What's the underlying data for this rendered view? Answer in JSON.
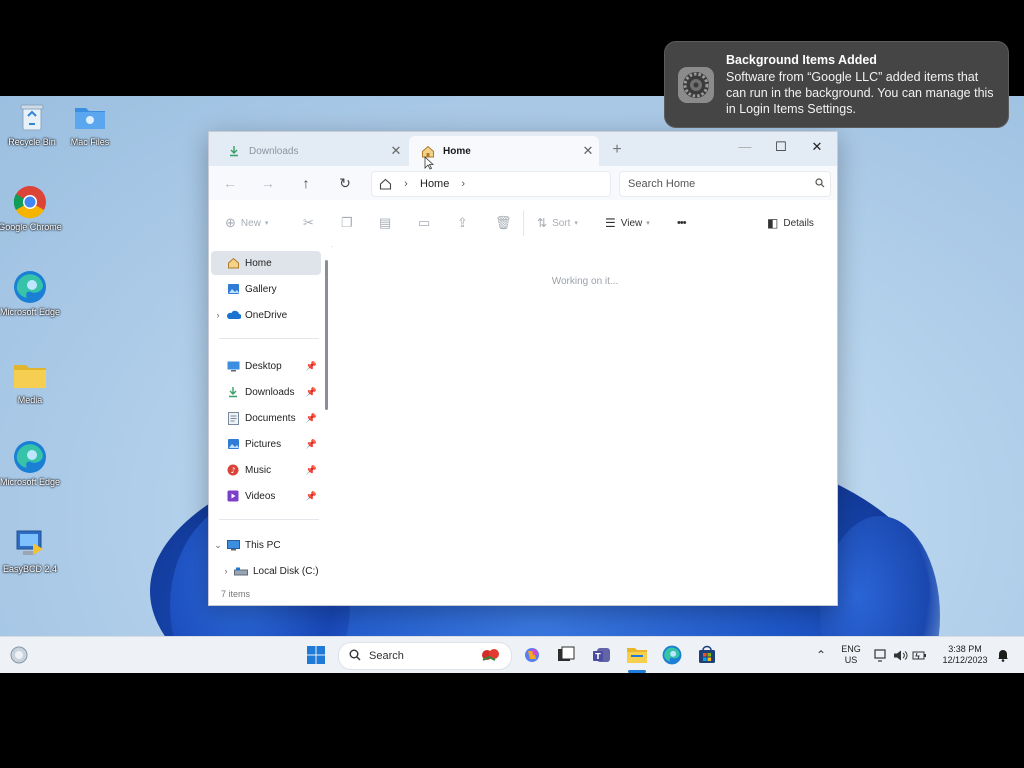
{
  "notification": {
    "title": "Background Items Added",
    "body": "Software from “Google LLC” added items that can run in the background. You can manage this in Login Items Settings."
  },
  "desktop": {
    "icons": [
      {
        "label": "Recycle Bin",
        "icon": "recycle-bin-icon"
      },
      {
        "label": "Mac Files",
        "icon": "folder-icon"
      },
      {
        "label": "Google Chrome",
        "icon": "chrome-icon"
      },
      {
        "label": "Microsoft Edge",
        "icon": "edge-icon"
      },
      {
        "label": "Media",
        "icon": "folder-icon"
      },
      {
        "label": "Microsoft Edge",
        "icon": "edge-icon"
      },
      {
        "label": "EasyBCD 2.4",
        "icon": "easybcd-icon"
      }
    ]
  },
  "explorer": {
    "tabs": [
      {
        "label": "Downloads",
        "active": false
      },
      {
        "label": "Home",
        "active": true
      }
    ],
    "new_tab": "+",
    "address": {
      "path": "Home"
    },
    "search": {
      "placeholder": "Search Home"
    },
    "commands": {
      "new": "New",
      "sort": "Sort",
      "view": "View",
      "more": "•••",
      "details": "Details"
    },
    "sidebar": {
      "items": [
        {
          "label": "Home",
          "icon": "home-icon",
          "selected": true
        },
        {
          "label": "Gallery",
          "icon": "gallery-icon"
        },
        {
          "label": "OneDrive",
          "icon": "onedrive-icon"
        },
        {
          "label": "Desktop",
          "icon": "desktop-icon",
          "pinned": true
        },
        {
          "label": "Downloads",
          "icon": "download-icon",
          "pinned": true
        },
        {
          "label": "Documents",
          "icon": "documents-icon",
          "pinned": true
        },
        {
          "label": "Pictures",
          "icon": "pictures-icon",
          "pinned": true
        },
        {
          "label": "Music",
          "icon": "music-icon",
          "pinned": true
        },
        {
          "label": "Videos",
          "icon": "videos-icon",
          "pinned": true
        },
        {
          "label": "This PC",
          "icon": "pc-icon"
        },
        {
          "label": "Local Disk (C:)",
          "icon": "disk-icon"
        }
      ]
    },
    "content": {
      "status": "Working on it..."
    },
    "status_bar": {
      "count": "7 items"
    }
  },
  "taskbar": {
    "search_label": "Search",
    "tray": {
      "lang_top": "ENG",
      "lang_bottom": "US",
      "time": "3:38 PM",
      "date": "12/12/2023"
    }
  },
  "colors": {
    "accent": "#0067c0",
    "notification_bg": "#454545",
    "desktop_bloom": "#1e56c8"
  }
}
